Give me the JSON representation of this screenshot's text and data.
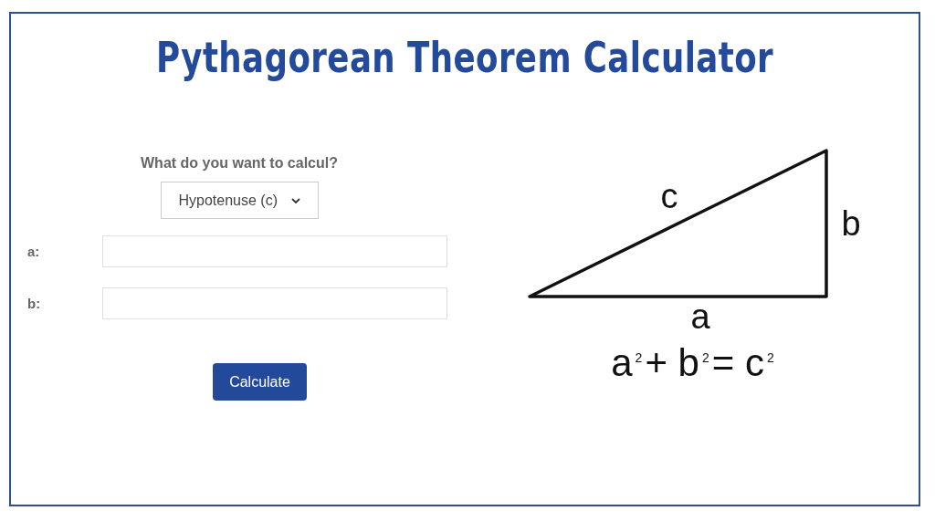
{
  "title": "Pythagorean Theorem Calculator",
  "form": {
    "question": "What do you want to calcul?",
    "select": {
      "value": "Hypotenuse (c)"
    },
    "fields": [
      {
        "label": "a:"
      },
      {
        "label": "b:"
      }
    ],
    "button": "Calculate"
  },
  "diagram": {
    "side_labels": [
      "c",
      "b",
      "a"
    ],
    "formula": "a$^{2}$+ b$^{2}$= c$^{2}$"
  }
}
